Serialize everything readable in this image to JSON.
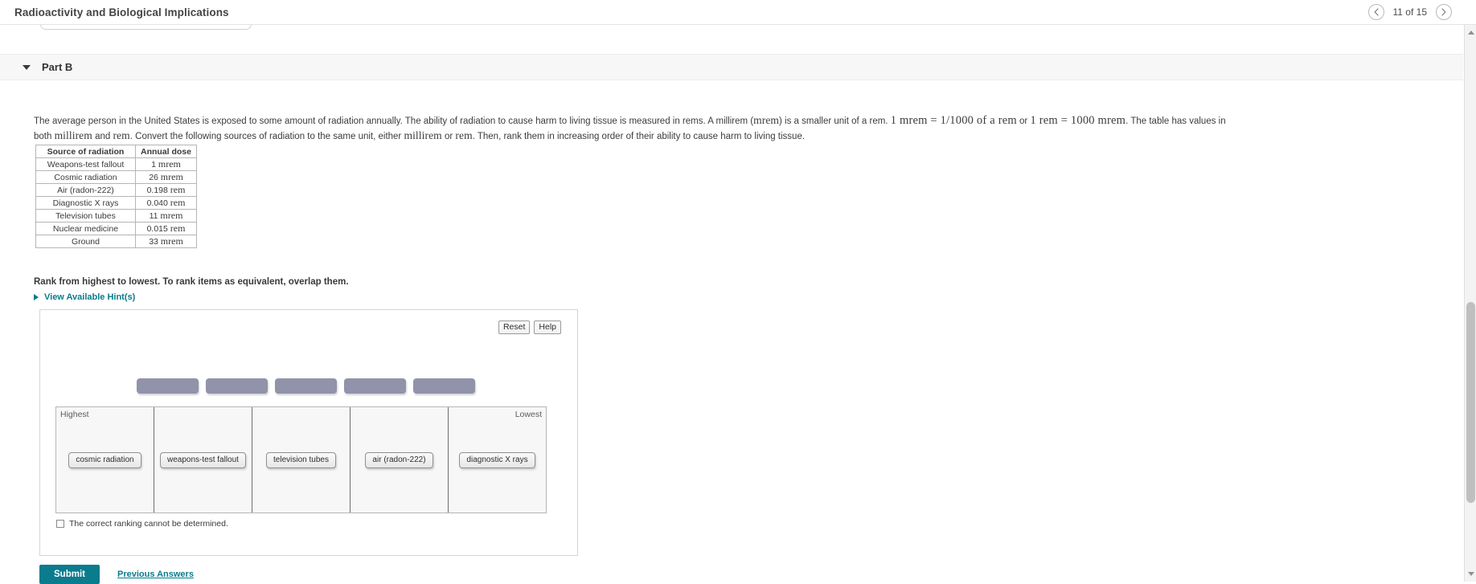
{
  "header": {
    "title": "Radioactivity and Biological Implications",
    "pager": {
      "label": "11 of 15",
      "prev_icon": "chevron-left-icon",
      "next_icon": "chevron-right-icon"
    }
  },
  "part": {
    "title": "Part B",
    "collapse_icon": "caret-down-icon"
  },
  "question": {
    "segments": [
      {
        "type": "text",
        "value": "The average person in the United States is exposed to some amount of radiation annually. The ability of radiation to cause harm to living tissue is measured in rems. A millirem ("
      },
      {
        "type": "unit",
        "value": "mrem"
      },
      {
        "type": "text",
        "value": ") is a smaller unit of a rem. "
      },
      {
        "type": "eq",
        "value": "1 mrem = 1/1000 of a rem"
      },
      {
        "type": "text",
        "value": " or "
      },
      {
        "type": "eq",
        "value": "1 rem = 1000 mrem"
      },
      {
        "type": "text",
        "value": ". The table has values in both "
      },
      {
        "type": "unit",
        "value": "millirem"
      },
      {
        "type": "text",
        "value": " and "
      },
      {
        "type": "unit",
        "value": "rem"
      },
      {
        "type": "text",
        "value": ". Convert the following sources of radiation to the same unit, either "
      },
      {
        "type": "unit",
        "value": "millirem"
      },
      {
        "type": "text",
        "value": " or "
      },
      {
        "type": "unit",
        "value": "rem"
      },
      {
        "type": "text",
        "value": ". Then, rank them in increasing order of their ability to cause harm to living tissue."
      }
    ]
  },
  "table": {
    "columns": [
      "Source of radiation",
      "Annual dose"
    ],
    "rows": [
      {
        "source": "Weapons-test fallout",
        "amount": "1",
        "unit": "mrem"
      },
      {
        "source": "Cosmic radiation",
        "amount": "26",
        "unit": "mrem"
      },
      {
        "source": "Air (radon-222)",
        "amount": "0.198",
        "unit": "rem"
      },
      {
        "source": "Diagnostic X rays",
        "amount": "0.040",
        "unit": "rem"
      },
      {
        "source": "Television tubes",
        "amount": "11",
        "unit": "mrem"
      },
      {
        "source": "Nuclear medicine",
        "amount": "0.015",
        "unit": "rem"
      },
      {
        "source": "Ground",
        "amount": "33",
        "unit": "mrem"
      }
    ]
  },
  "instructions": {
    "rank_text": "Rank from highest to lowest. To rank items as equivalent, overlap them.",
    "hint_link": "View Available Hint(s)",
    "hint_icon": "caret-right-icon"
  },
  "panel": {
    "reset_label": "Reset",
    "help_label": "Help",
    "bank_slots": 5,
    "bank_color": "#9193aa",
    "bins": {
      "highest_label": "Highest",
      "lowest_label": "Lowest",
      "items": [
        "cosmic radiation",
        "weapons-test fallout",
        "television tubes",
        "air (radon-222)",
        "diagnostic X rays"
      ]
    },
    "checkbox": {
      "label": "The correct ranking cannot be determined.",
      "checked": false
    }
  },
  "footer": {
    "submit_label": "Submit",
    "previous_answers_label": "Previous Answers",
    "accent_color": "#0b7b8e"
  },
  "scrollbar": {
    "up_icon": "triangle-up-icon",
    "down_icon": "triangle-down-icon"
  }
}
